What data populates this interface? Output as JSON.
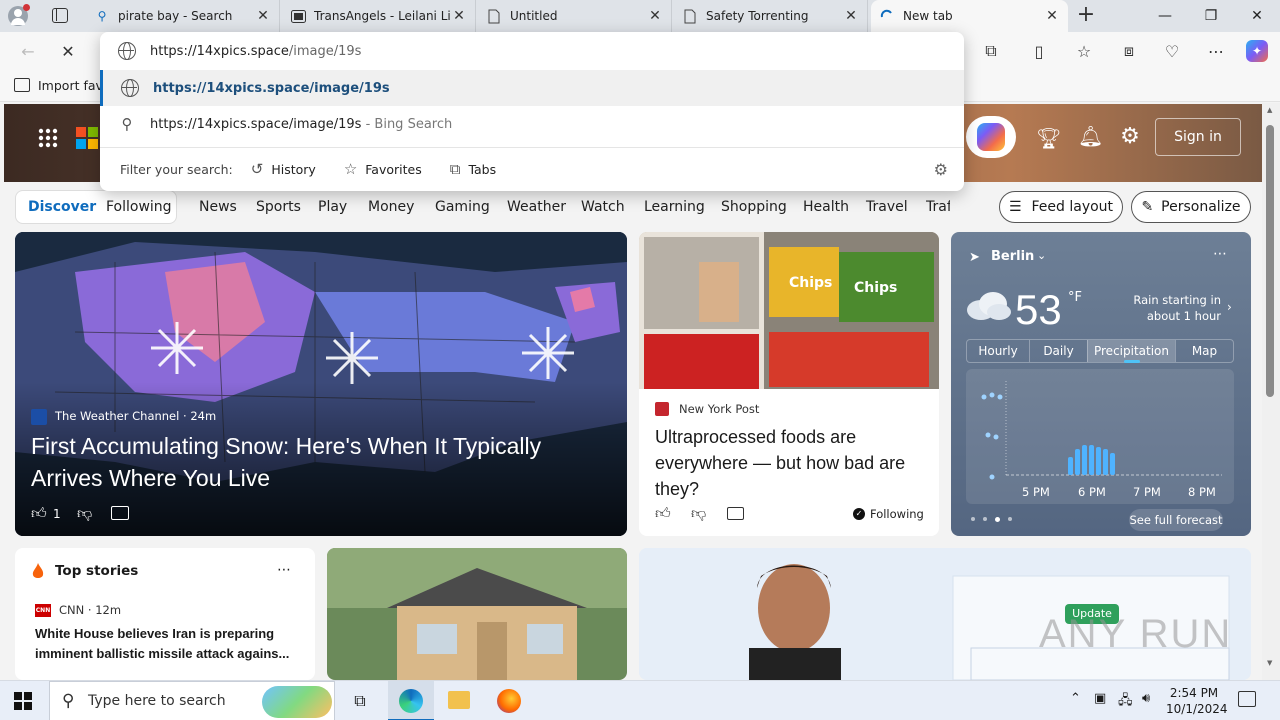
{
  "tabs": [
    {
      "title": "pirate bay - Search",
      "icon": "search-icon",
      "active": false
    },
    {
      "title": "TransAngels - Leilani Li, E",
      "icon": "film-icon",
      "active": false
    },
    {
      "title": "Untitled",
      "icon": "page-icon",
      "active": false
    },
    {
      "title": "Safety Torrenting",
      "icon": "page-icon",
      "active": false
    },
    {
      "title": "New tab",
      "icon": "loading-icon",
      "active": true
    }
  ],
  "omnibox": {
    "url_host": "https://14xpics.space",
    "url_path": "/image/19s",
    "suggestion_url": "https://14xpics.space/image/19s",
    "search_text": "https://14xpics.space/image/19s",
    "search_suffix": " - Bing Search",
    "filter_label": "Filter your search:",
    "filters": [
      "History",
      "Favorites",
      "Tabs"
    ]
  },
  "favbar": {
    "import_label": "Import favo"
  },
  "page": {
    "sign_in": "Sign in",
    "nav_active": "Discover",
    "nav": [
      "Discover",
      "Following",
      "News",
      "Sports",
      "Play",
      "Money",
      "Gaming",
      "Weather",
      "Watch",
      "Learning",
      "Shopping",
      "Health",
      "Travel",
      "Traf"
    ],
    "feed_layout": "Feed layout",
    "personalize": "Personalize",
    "main_story": {
      "source": "The Weather Channel",
      "age": "24m",
      "title": "First Accumulating Snow: Here's When It Typically Arrives Where You Live",
      "likes": "1"
    },
    "story2": {
      "source": "New York Post",
      "title": "Ultraprocessed foods are everywhere — but how bad are they?",
      "following": "Following"
    },
    "weather": {
      "city": "Berlin",
      "temp": "53",
      "unit": "°F",
      "summary": "Rain starting in about 1 hour",
      "tabs": [
        "Hourly",
        "Daily",
        "Precipitation",
        "Map"
      ],
      "active_tab": "Precipitation",
      "times": [
        "5 PM",
        "6 PM",
        "7 PM",
        "8 PM"
      ],
      "see_full": "See full forecast"
    },
    "top_stories": {
      "title": "Top stories",
      "source": "CNN",
      "age": "12m",
      "headline": "White House believes Iran is preparing imminent ballistic missile attack agains..."
    },
    "video": {
      "badge": "Update"
    },
    "watermark": "ANY RUN"
  },
  "taskbar": {
    "search_placeholder": "Type here to search",
    "time": "2:54 PM",
    "date": "10/1/2024"
  },
  "colors": {
    "accent": "#0f6cbd",
    "tabstrip": "#dfe3e8",
    "taskbar": "#e8eef8"
  }
}
